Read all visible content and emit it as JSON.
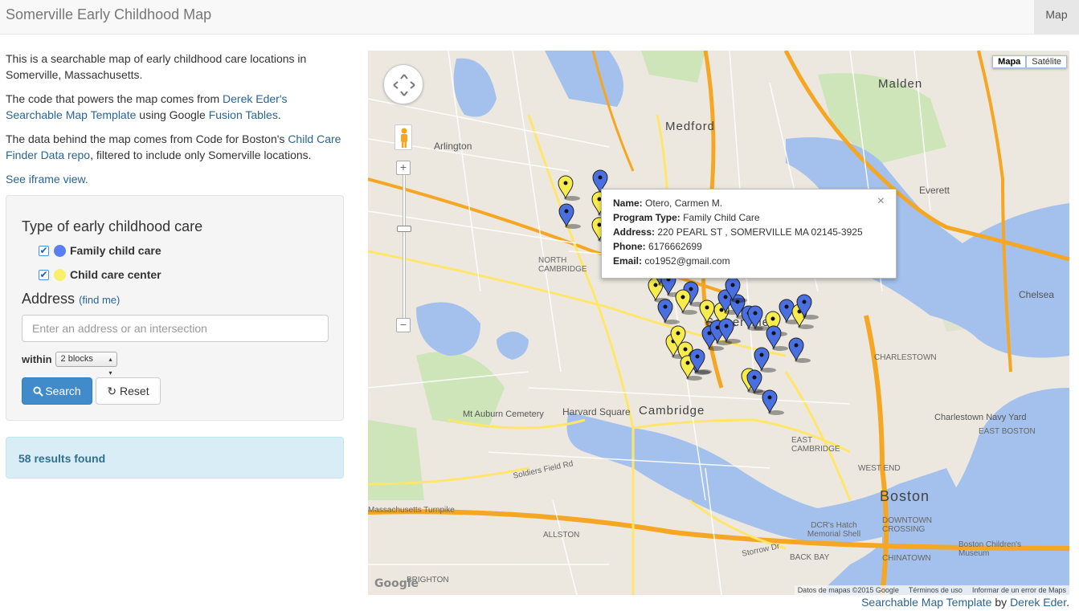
{
  "navbar": {
    "title": "Somerville Early Childhood Map",
    "nav_item": "Map"
  },
  "intro": {
    "p1": "This is a searchable map of early childhood care locations in Somerville, Massachusetts.",
    "p2_pre": "The code that powers the map comes from ",
    "p2_link1": "Derek Eder's Searchable Map Template",
    "p2_mid": " using Google ",
    "p2_link2": "Fusion Tables",
    "p2_post": ".",
    "p3_pre": "The data behind the map comes from Code for Boston's ",
    "p3_link": "Child Care Finder Data repo",
    "p3_post": ", filtered to include only Somerville locations.",
    "iframe_link": "See iframe view."
  },
  "filters": {
    "heading": "Type of early childhood care",
    "types": [
      {
        "label": "Family child care",
        "checked": true,
        "color": "#5b7ff2"
      },
      {
        "label": "Child care center",
        "checked": true,
        "color": "#f6f06a"
      }
    ],
    "address_label": "Address",
    "find_me": "(find me)",
    "address_placeholder": "Enter an address or an intersection",
    "within_label": "within",
    "within_value": "2 blocks",
    "search_label": "Search",
    "reset_label": "Reset"
  },
  "results": {
    "text": "58 results found"
  },
  "map": {
    "type_buttons": [
      "Mapa",
      "Satélite"
    ],
    "active_type": "Mapa",
    "info_window": {
      "name_label": "Name:",
      "name": "Otero, Carmen M.",
      "program_label": "Program Type:",
      "program": "Family Child Care",
      "address_label": "Address:",
      "address": "220 PEARL ST , SOMERVILLE MA 02145-3925",
      "phone_label": "Phone:",
      "phone": "6176662699",
      "email_label": "Email:",
      "email": "co1952@gmail.com"
    },
    "place_labels": {
      "medford": "Medford",
      "malden": "Malden",
      "arlington": "Arlington",
      "everett": "Everett",
      "chelsea": "Chelsea",
      "somerville": "Somerville",
      "cambridge": "Cambridge",
      "boston": "Boston",
      "north_cambridge": "NORTH CAMBRIDGE",
      "charlestown": "CHARLESTOWN",
      "east_cambridge": "EAST CAMBRIDGE",
      "west_end": "WEST END",
      "downtown_crossing": "DOWNTOWN CROSSING",
      "chinatown": "CHINATOWN",
      "back_bay": "BACK BAY",
      "allston": "ALLSTON",
      "brighton": "BRIGHTON",
      "east_boston": "EAST BOSTON",
      "harvard_square": "Harvard Square",
      "mt_auburn": "Mt Auburn Cemetery",
      "charlestown_navy_yard": "Charlestown Navy Yard",
      "dcr_hatch": "DCR's Hatch Memorial Shell",
      "childrens_museum": "Boston Children's Museum",
      "soldiers_field": "Soldiers Field Rd",
      "mass_turnpike": "Massachusetts Turnpike",
      "storrow": "Storrow Dr"
    },
    "attribution": {
      "data": "Datos de mapas ©2015 Google",
      "terms": "Términos de uso",
      "report": "Informar de un error de Maps"
    },
    "logo": "Google"
  },
  "footer": {
    "link1": "Searchable Map Template",
    "by": " by ",
    "link2": "Derek Eder",
    "end": "."
  }
}
